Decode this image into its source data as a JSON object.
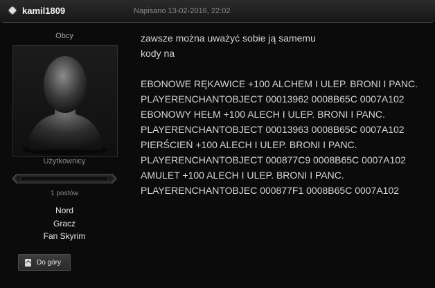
{
  "post": {
    "username": "kamil1809",
    "date": "Napisano 13-02-2016, 22:02"
  },
  "author": {
    "member_title": "Obcy",
    "group": "Użytkownicy",
    "post_count": "1 postów",
    "fields": [
      "Nord",
      "Gracz",
      "Fan Skyrim"
    ],
    "back_to_top": "Do góry",
    "reputation_fraction": 0
  },
  "body": {
    "lines": [
      "zawsze można uważyć sobie ją samemu",
      "kody na",
      "",
      "EBONOWE RĘKAWICE +100 ALCHEM I ULEP. BRONI I PANC.",
      "PLAYERENCHANTOBJECT 00013962 0008B65C 0007A102",
      "EBONOWY HEŁM +100 ALECH I ULEP. BRONI I PANC.",
      "PLAYERENCHANTOBJECT 00013963 0008B65C 0007A102",
      "PIERŚCIEŃ +100 ALECH I ULEP. BRONI I PANC.",
      "PLAYERENCHANTOBJECT 000877C9 0008B65C 0007A102",
      "AMULET +100 ALECH I ULEP. BRONI I PANC.",
      "PLAYERENCHANTOBJEC 000877F1 0008B65C 0007A102"
    ]
  },
  "icons": {
    "header": "diamond-icon",
    "avatar": "default-avatar-icon",
    "back_to_top": "page-up-icon"
  }
}
